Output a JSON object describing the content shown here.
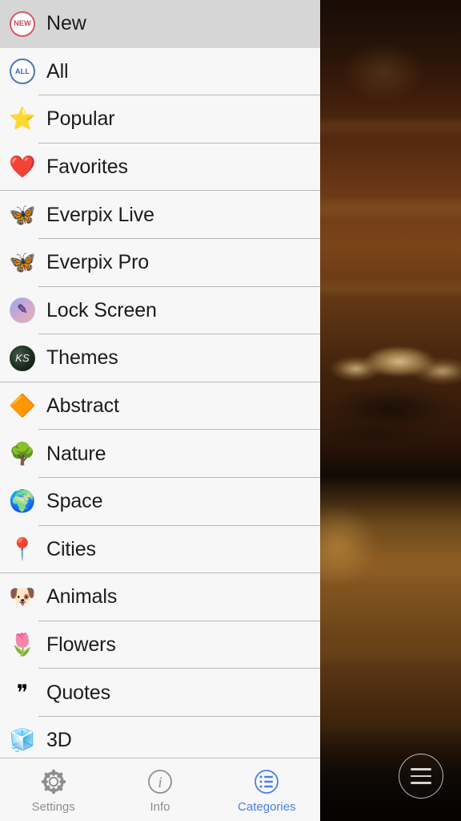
{
  "sidebar": {
    "items": [
      {
        "label": "New",
        "icon": "new-badge-icon",
        "glyph": "NEW",
        "selected": true,
        "separator": "none"
      },
      {
        "label": "All",
        "icon": "all-badge-icon",
        "glyph": "ALL",
        "selected": false,
        "separator": "inset"
      },
      {
        "label": "Popular",
        "icon": "star-icon",
        "glyph": "⭐",
        "selected": false,
        "separator": "inset"
      },
      {
        "label": "Favorites",
        "icon": "heart-icon",
        "glyph": "❤️",
        "selected": false,
        "separator": "full"
      },
      {
        "label": "Everpix Live",
        "icon": "butterfly-orange-icon",
        "glyph": "🦋",
        "selected": false,
        "separator": "inset"
      },
      {
        "label": "Everpix Pro",
        "icon": "butterfly-blue-icon",
        "glyph": "🦋",
        "selected": false,
        "separator": "inset"
      },
      {
        "label": "Lock Screen",
        "icon": "lock-screen-icon",
        "glyph": "✎",
        "selected": false,
        "separator": "inset"
      },
      {
        "label": "Themes",
        "icon": "themes-badge-icon",
        "glyph": "KS",
        "selected": false,
        "separator": "full"
      },
      {
        "label": "Abstract",
        "icon": "abstract-diamond-icon",
        "glyph": "🔶",
        "selected": false,
        "separator": "inset"
      },
      {
        "label": "Nature",
        "icon": "tree-icon",
        "glyph": "🌳",
        "selected": false,
        "separator": "inset"
      },
      {
        "label": "Space",
        "icon": "globe-icon",
        "glyph": "🌍",
        "selected": false,
        "separator": "inset"
      },
      {
        "label": "Cities",
        "icon": "map-pin-icon",
        "glyph": "📍",
        "selected": false,
        "separator": "full"
      },
      {
        "label": "Animals",
        "icon": "dog-face-icon",
        "glyph": "🐶",
        "selected": false,
        "separator": "inset"
      },
      {
        "label": "Flowers",
        "icon": "tulip-icon",
        "glyph": "🌷",
        "selected": false,
        "separator": "inset"
      },
      {
        "label": "Quotes",
        "icon": "quote-marks-icon",
        "glyph": "❞",
        "selected": false,
        "separator": "inset"
      },
      {
        "label": "3D",
        "icon": "cube-icon",
        "glyph": "🧊",
        "selected": false,
        "separator": "inset"
      }
    ]
  },
  "tab_bar": {
    "tabs": [
      {
        "label": "Settings",
        "icon": "gear-icon",
        "active": false
      },
      {
        "label": "Info",
        "icon": "info-icon",
        "active": false
      },
      {
        "label": "Categories",
        "icon": "list-icon",
        "active": true
      }
    ]
  },
  "preview": {
    "fab": {
      "icon": "hamburger-menu-icon"
    }
  },
  "colors": {
    "accent": "#4a7fe8",
    "inactive_tab": "#8e8e8e",
    "sidebar_bg": "#f7f7f7",
    "selected_row_bg": "#d6d6d6",
    "separator": "#b9b9b9",
    "label_text": "#1c1c1c",
    "wallpaper_sky": "#7b4419"
  }
}
